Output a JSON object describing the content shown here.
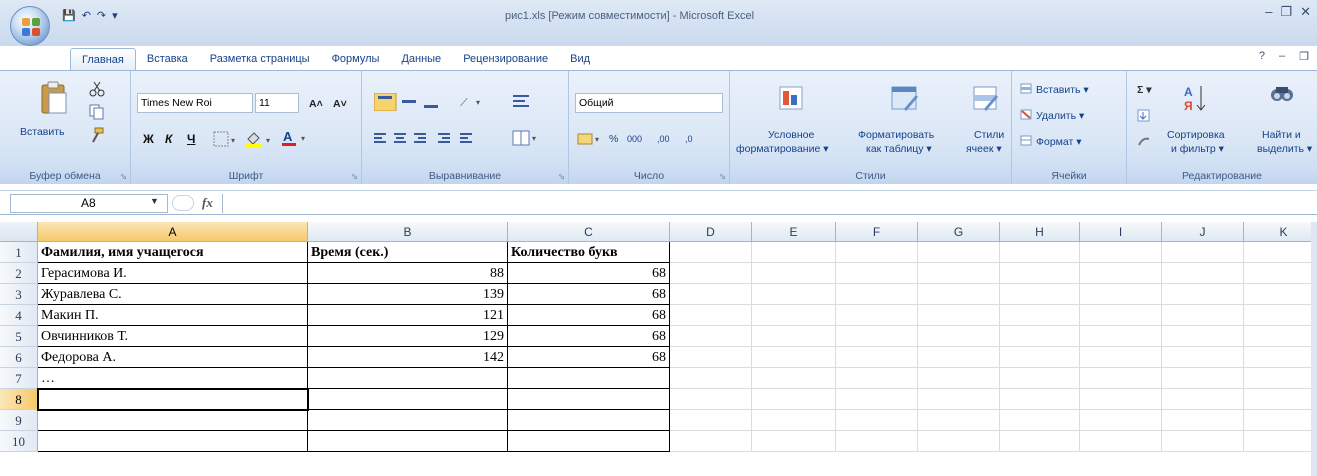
{
  "app": {
    "title": "рис1.xls  [Режим совместимости] - Microsoft Excel",
    "window_controls": [
      "–",
      "❐",
      "✕"
    ],
    "help_controls": [
      "?",
      "–",
      "❐"
    ]
  },
  "quick_access": [
    "💾",
    "↶",
    "↷",
    "▾"
  ],
  "tabs": [
    {
      "label": "Главная",
      "active": true
    },
    {
      "label": "Вставка"
    },
    {
      "label": "Разметка страницы"
    },
    {
      "label": "Формулы"
    },
    {
      "label": "Данные"
    },
    {
      "label": "Рецензирование"
    },
    {
      "label": "Вид"
    }
  ],
  "ribbon": {
    "clipboard": {
      "label": "Буфер обмена",
      "paste": "Вставить"
    },
    "font": {
      "label": "Шрифт",
      "font_name": "Times New Roi",
      "font_size": "11",
      "bold": "Ж",
      "italic": "К",
      "underline": "Ч",
      "grow": "A˄",
      "shrink": "A˅"
    },
    "alignment": {
      "label": "Выравнивание"
    },
    "number": {
      "label": "Число",
      "format": "Общий",
      "percent": "%",
      "thousands": "000",
      "inc_decimal": ",00",
      "dec_decimal": ",0"
    },
    "styles": {
      "label": "Стили",
      "conditional_1": "Условное",
      "conditional_2": "форматирование ▾",
      "as_table_1": "Форматировать",
      "as_table_2": "как таблицу ▾",
      "cell_styles_1": "Стили",
      "cell_styles_2": "ячеек ▾"
    },
    "cells": {
      "label": "Ячейки",
      "insert": "Вставить ▾",
      "delete": "Удалить ▾",
      "format": "Формат ▾"
    },
    "editing": {
      "label": "Редактирование",
      "sort_1": "Сортировка",
      "sort_2": "и фильтр ▾",
      "find_1": "Найти и",
      "find_2": "выделить ▾",
      "sum": "Σ ▾"
    }
  },
  "formula_bar": {
    "name_box": "A8",
    "fx": "fx",
    "formula": ""
  },
  "sheet": {
    "columns": [
      "A",
      "B",
      "C",
      "D",
      "E",
      "F",
      "G",
      "H",
      "I",
      "J",
      "K"
    ],
    "rows": [
      "1",
      "2",
      "3",
      "4",
      "5",
      "6",
      "7",
      "8",
      "9",
      "10"
    ],
    "selected_cell": "A8",
    "header": [
      "Фамилия, имя учащегося",
      "Время (сек.)",
      "Количество букв"
    ],
    "data": [
      [
        "Герасимова И.",
        "88",
        "68"
      ],
      [
        "Журавлева С.",
        "139",
        "68"
      ],
      [
        "Макин П.",
        "121",
        "68"
      ],
      [
        "Овчинников Т.",
        "129",
        "68"
      ],
      [
        "Федорова А.",
        "142",
        "68"
      ],
      [
        "…",
        "",
        ""
      ],
      [
        "",
        "",
        ""
      ],
      [
        "",
        "",
        ""
      ],
      [
        "",
        "",
        ""
      ]
    ]
  },
  "colors": {
    "accent": "#15428b",
    "ribbon_bg": "#dbe7f6",
    "selected_header": "#f7c86b"
  }
}
